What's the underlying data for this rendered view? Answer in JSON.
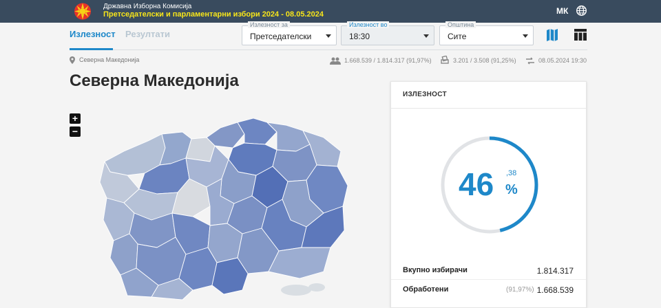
{
  "header": {
    "org": "Државна Изборна Комисија",
    "election": "Претседателски и парламентарни избори 2024 - 08.05.2024",
    "language": "МК"
  },
  "tabs": {
    "turnout": "Излезност",
    "results": "Резултати"
  },
  "filters": {
    "turnout_for": {
      "label": "Излезност за",
      "value": "Претседателски"
    },
    "turnout_at": {
      "label": "Излезност во",
      "value": "18:30"
    },
    "municipality": {
      "label": "Општина",
      "value": "Сите"
    }
  },
  "breadcrumb": "Северна Македонија",
  "stats": {
    "voters": "1.668.539 / 1.814.317 (91,97%)",
    "stations": "3.201 / 3.508 (91,25%)",
    "updated": "08.05.2024 19:30"
  },
  "page_title": "Северна Македонија",
  "map": {
    "zoom_in": "+",
    "zoom_out": "−"
  },
  "card": {
    "title": "ИЗЛЕЗНОСТ",
    "turnout_percent": 46.38,
    "turnout_int": "46",
    "turnout_dec": ",38",
    "percent_sign": "%",
    "rows": [
      {
        "label": "Вкупно избирачи",
        "pct": "",
        "value": "1.814.317"
      },
      {
        "label": "Обработени",
        "pct": "(91,97%)",
        "value": "1.668.539"
      }
    ]
  },
  "colors": {
    "topbar": "#394b5e",
    "accent": "#1e88c9",
    "election_text": "#f7e51a"
  },
  "icons": [
    "logo",
    "globe-icon",
    "map-view-icon",
    "table-view-icon",
    "location-pin-icon",
    "people-icon",
    "ballot-box-icon",
    "sync-icon"
  ]
}
